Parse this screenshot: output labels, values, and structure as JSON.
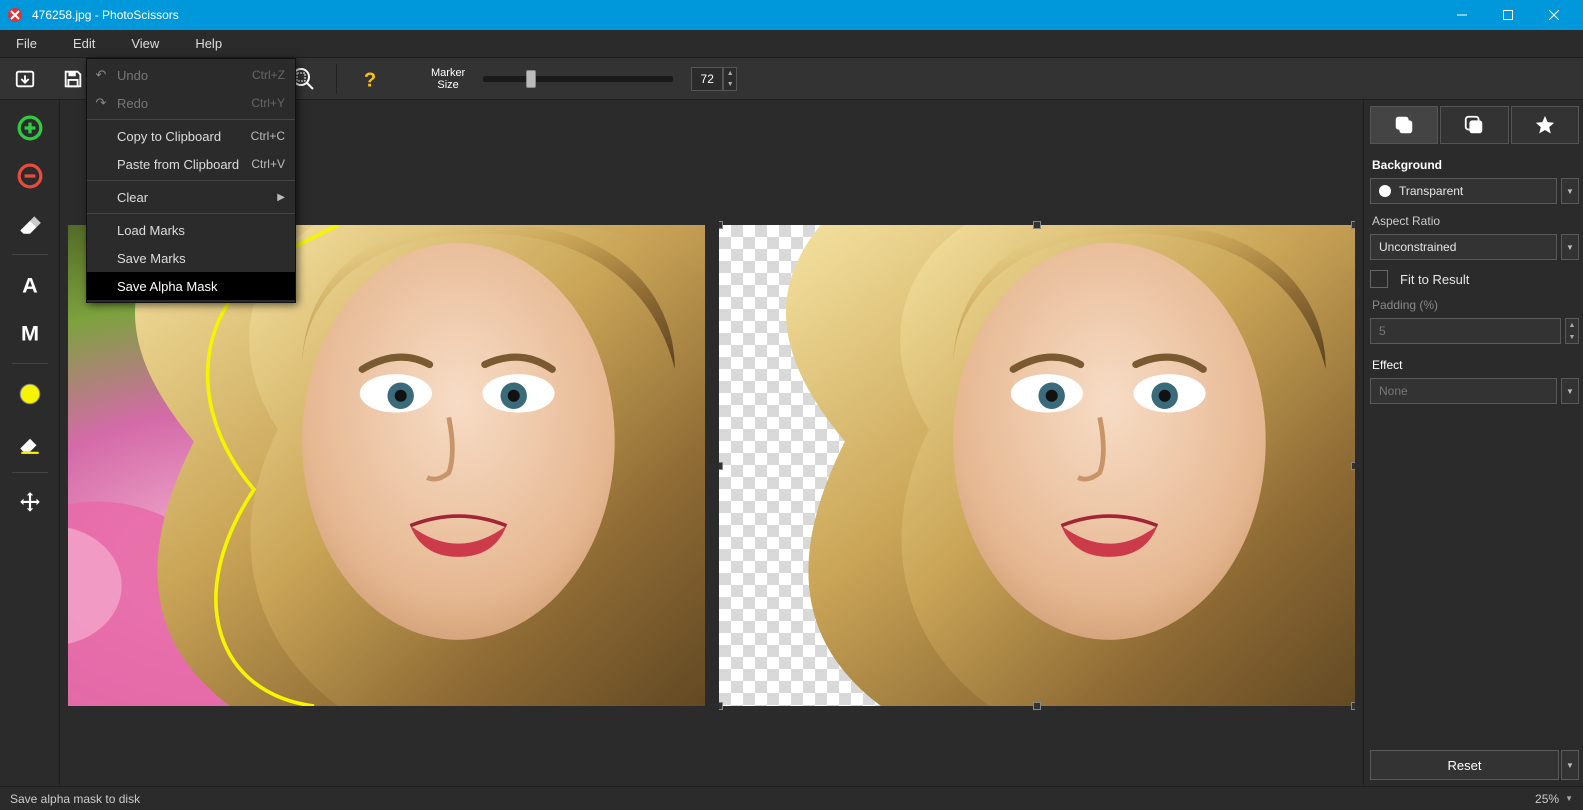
{
  "titlebar": {
    "title": "476258.jpg - PhotoScissors"
  },
  "menubar": {
    "file": "File",
    "edit": "Edit",
    "view": "View",
    "help": "Help"
  },
  "edit_menu": {
    "undo": "Undo",
    "undo_sc": "Ctrl+Z",
    "redo": "Redo",
    "redo_sc": "Ctrl+Y",
    "copy": "Copy to Clipboard",
    "copy_sc": "Ctrl+C",
    "paste": "Paste from Clipboard",
    "paste_sc": "Ctrl+V",
    "clear": "Clear",
    "load_marks": "Load Marks",
    "save_marks": "Save Marks",
    "save_alpha": "Save Alpha Mask"
  },
  "toolbar": {
    "marker_label_l1": "Marker",
    "marker_label_l2": "Size",
    "marker_value": "72"
  },
  "right_panel": {
    "background_label": "Background",
    "background_value": "Transparent",
    "aspect_label": "Aspect Ratio",
    "aspect_value": "Unconstrained",
    "fit_label": "Fit to Result",
    "padding_label": "Padding (%)",
    "padding_value": "5",
    "effect_label": "Effect",
    "effect_value": "None",
    "reset_label": "Reset"
  },
  "statusbar": {
    "message": "Save alpha mask to disk",
    "zoom": "25%"
  }
}
